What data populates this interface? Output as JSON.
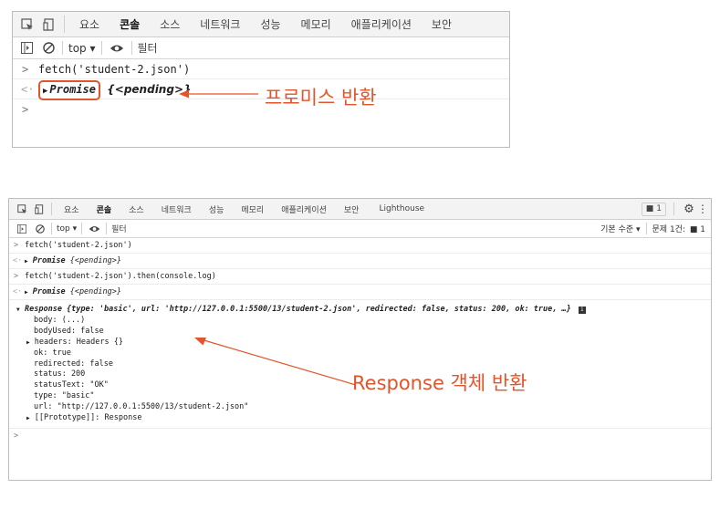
{
  "top_panel": {
    "tabs": [
      "요소",
      "콘솔",
      "소스",
      "네트워크",
      "성능",
      "메모리",
      "애플리케이션",
      "보안"
    ],
    "active_tab": "콘솔",
    "context": "top ▾",
    "filter": "필터",
    "lines": {
      "command": "fetch('student-2.json')",
      "result_keyword": "Promise",
      "result_state": "{<pending>}"
    },
    "annotation": "프로미스 반환"
  },
  "bottom_panel": {
    "tabs": [
      "요소",
      "콘솔",
      "소스",
      "네트워크",
      "성능",
      "메모리",
      "애플리케이션",
      "보안",
      "Lighthouse"
    ],
    "active_tab": "콘솔",
    "message_badge": "1",
    "context": "top ▾",
    "filter": "필터",
    "default_levels": "기본 수준 ▾",
    "issues": "문제 1건:",
    "issues_count": "1",
    "lines": {
      "cmd1": "fetch('student-2.json')",
      "res1_keyword": "Promise",
      "res1_state": "{<pending>}",
      "cmd2": "fetch('student-2.json').then(console.log)",
      "res2_keyword": "Promise",
      "res2_state": "{<pending>}",
      "response_summary": "Response {type: 'basic', url: 'http://127.0.0.1:5500/13/student-2.json', redirected: false, status: 200, ok: true, …}",
      "props": [
        "body: (...)",
        "bodyUsed: false",
        "headers: Headers {}",
        "ok: true",
        "redirected: false",
        "status: 200",
        "statusText: \"OK\"",
        "type: \"basic\"",
        "url: \"http://127.0.0.1:5500/13/student-2.json\"",
        "[[Prototype]]: Response"
      ]
    },
    "annotation": "Response 객체 반환"
  },
  "colors": {
    "annotation": "#e2542a",
    "highlight_box": "#e2542a"
  }
}
